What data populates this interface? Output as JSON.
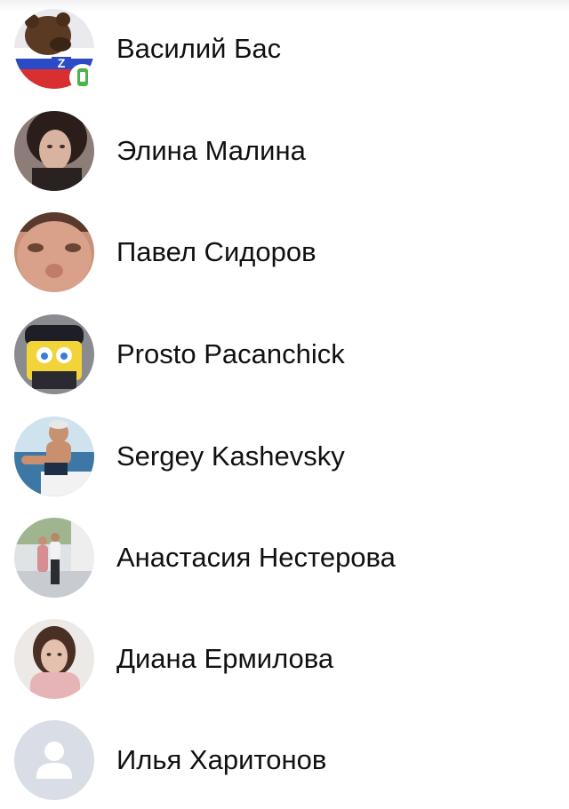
{
  "friends": [
    {
      "name": "Василий Бас",
      "avatar_icon": "bear-russia-flag-avatar",
      "mobile_online": true
    },
    {
      "name": "Элина Малина",
      "avatar_icon": "woman-portrait-avatar",
      "mobile_online": false
    },
    {
      "name": "Павел Сидоров",
      "avatar_icon": "man-face-closeup-avatar",
      "mobile_online": false
    },
    {
      "name": "Prosto Pacanchick",
      "avatar_icon": "spongebob-avatar",
      "mobile_online": false
    },
    {
      "name": "Sergey Kashevsky",
      "avatar_icon": "man-on-boat-avatar",
      "mobile_online": false
    },
    {
      "name": "Анастасия Нестерова",
      "avatar_icon": "couple-photo-avatar",
      "mobile_online": false
    },
    {
      "name": "Диана Ермилова",
      "avatar_icon": "woman-pink-scarf-avatar",
      "mobile_online": false
    },
    {
      "name": "Илья Харитонов",
      "avatar_icon": "default-user-avatar",
      "mobile_online": false
    }
  ],
  "colors": {
    "text": "#111111",
    "online_mobile": "#4bb34b",
    "placeholder_bg": "#d8dde6",
    "placeholder_fg": "#ffffff"
  }
}
